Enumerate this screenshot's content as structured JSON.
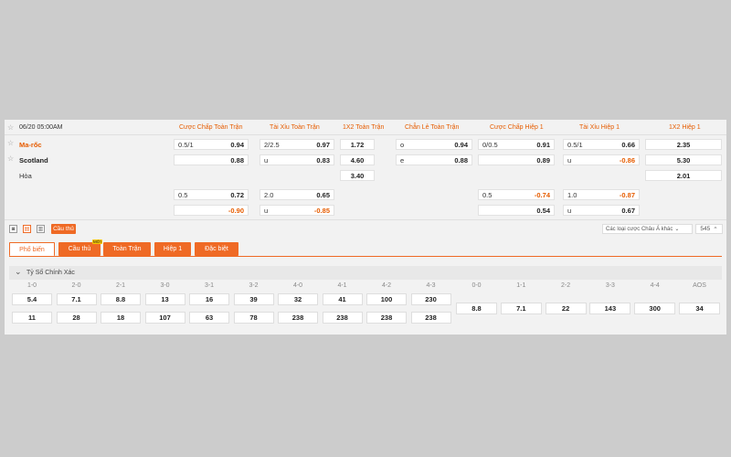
{
  "match": {
    "datetime": "06/20 05:00AM",
    "home": "Ma-rốc",
    "away": "Scotland",
    "draw": "Hòa"
  },
  "headers": [
    "Cược Chấp Toàn Trận",
    "Tài Xỉu Toàn Trận",
    "1X2 Toàn Trận",
    "Chẵn Lẻ Toàn Trận",
    "Cược Chấp Hiệp 1",
    "Tài Xỉu Hiệp 1",
    "1X2 Hiệp 1"
  ],
  "rows": {
    "r1": {
      "hdp_l": "0.5/1",
      "hdp_v": "0.94",
      "ou_l": "2/2.5",
      "ou_v": "0.97",
      "x12": "1.72",
      "oe_l": "o",
      "oe_v": "0.94",
      "h1hdp_l": "0/0.5",
      "h1hdp_v": "0.91",
      "h1ou_l": "0.5/1",
      "h1ou_v": "0.66",
      "h1x12": "2.35"
    },
    "r2": {
      "hdp_v": "0.88",
      "ou_l": "u",
      "ou_v": "0.83",
      "x12": "4.60",
      "oe_l": "e",
      "oe_v": "0.88",
      "h1hdp_v": "0.89",
      "h1ou_l": "u",
      "h1ou_v": "-0.86",
      "h1x12": "5.30"
    },
    "r3": {
      "x12": "3.40",
      "h1x12": "2.01"
    },
    "r4": {
      "hdp_l": "0.5",
      "hdp_v": "0.72",
      "ou_l": "2.0",
      "ou_v": "0.65",
      "h1hdp_l": "0.5",
      "h1hdp_v": "-0.74",
      "h1ou_l": "1.0",
      "h1ou_v": "-0.87"
    },
    "r5": {
      "hdp_v": "-0.90",
      "ou_l": "u",
      "ou_v": "-0.85",
      "h1hdp_v": "0.54",
      "h1ou_l": "u",
      "h1ou_v": "0.67"
    }
  },
  "toolbar": {
    "player_btn": "Cầu thủ",
    "other_bets": "Các loại cược Châu Á khác",
    "count": "545"
  },
  "tabs": [
    "Phổ biến",
    "Cầu thủ",
    "Toàn Trận",
    "Hiệp 1",
    "Đặc biệt"
  ],
  "new_badge": "MỚI",
  "section_title": "Tỷ Số Chính Xác",
  "scores": {
    "labels": [
      "1-0",
      "2-0",
      "2-1",
      "3-0",
      "3-1",
      "3-2",
      "4-0",
      "4-1",
      "4-2",
      "4-3"
    ],
    "row1": [
      "5.4",
      "7.1",
      "8.8",
      "13",
      "16",
      "39",
      "32",
      "41",
      "100",
      "230"
    ],
    "row2": [
      "11",
      "28",
      "18",
      "107",
      "63",
      "78",
      "238",
      "238",
      "238",
      "238"
    ],
    "draw_labels": [
      "0-0",
      "1-1",
      "2-2",
      "3-3",
      "4-4",
      "AOS"
    ],
    "draw_values": [
      "8.8",
      "7.1",
      "22",
      "143",
      "300",
      "34"
    ]
  },
  "colors": {
    "accent": "#ef6a25",
    "negative": "#e65c00",
    "background": "#cccccc",
    "panel": "#f2f2f2"
  }
}
